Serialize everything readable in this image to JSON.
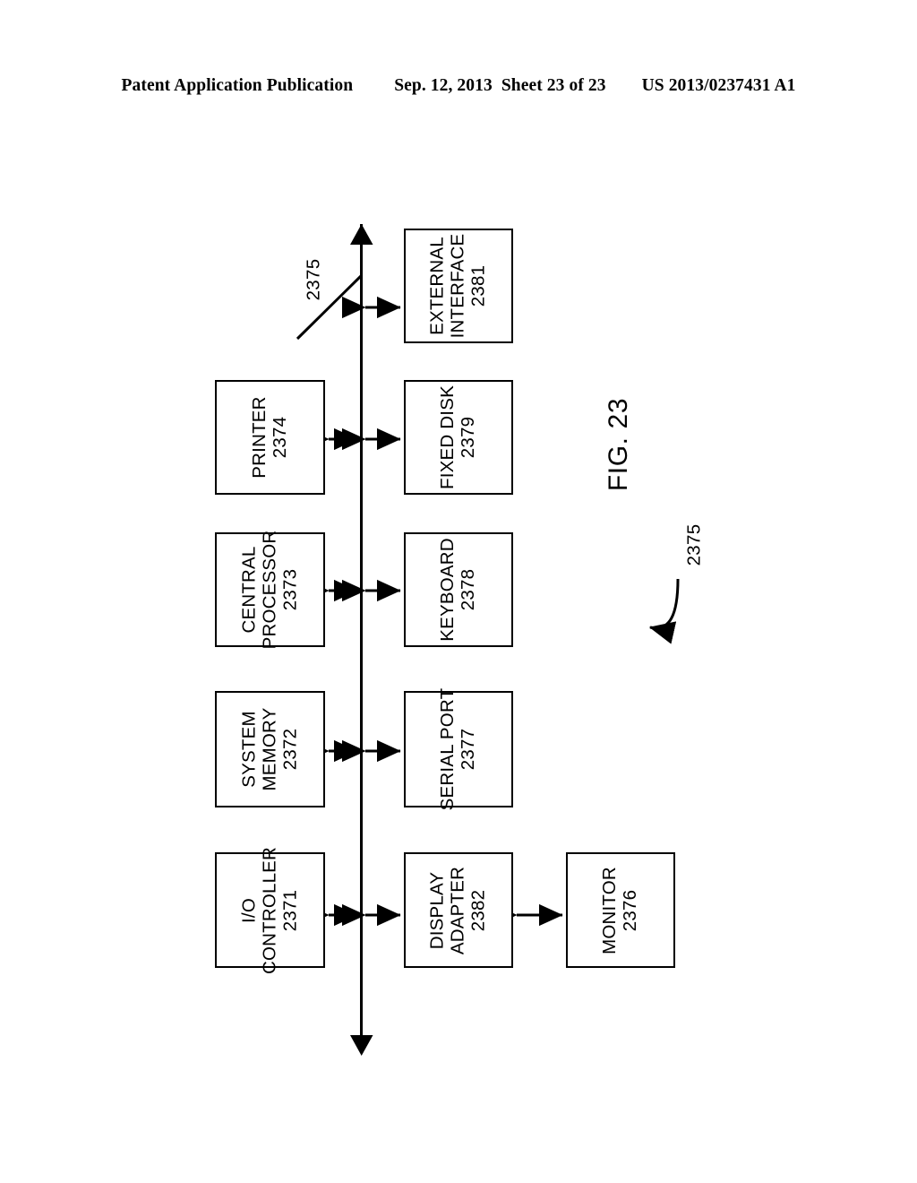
{
  "header": {
    "publication": "Patent Application Publication",
    "date": "Sep. 12, 2013",
    "sheet": "Sheet 23 of 23",
    "patent_number": "US 2013/0237431 A1"
  },
  "figure": {
    "label": "FIG. 23",
    "bus_reference": "2375",
    "bus_reference_secondary": "2375",
    "blocks": [
      {
        "id": "external-interface",
        "line1": "EXTERNAL",
        "line2": "INTERFACE",
        "ref": "2381"
      },
      {
        "id": "printer",
        "line1": "PRINTER",
        "line2": "",
        "ref": "2374"
      },
      {
        "id": "fixed-disk",
        "line1": "FIXED DISK",
        "line2": "",
        "ref": "2379"
      },
      {
        "id": "central-processor",
        "line1": "CENTRAL",
        "line2": "PROCESSOR",
        "ref": "2373"
      },
      {
        "id": "keyboard",
        "line1": "KEYBOARD",
        "line2": "",
        "ref": "2378"
      },
      {
        "id": "system-memory",
        "line1": "SYSTEM",
        "line2": "MEMORY",
        "ref": "2372"
      },
      {
        "id": "serial-port",
        "line1": "SERIAL PORT",
        "line2": "",
        "ref": "2377"
      },
      {
        "id": "io-controller",
        "line1": "I/O",
        "line2": "CONTROLLER",
        "ref": "2371"
      },
      {
        "id": "display-adapter",
        "line1": "DISPLAY",
        "line2": "ADAPTER",
        "ref": "2382"
      },
      {
        "id": "monitor",
        "line1": "MONITOR",
        "line2": "",
        "ref": "2376"
      }
    ],
    "colors": {
      "ink": "#000000",
      "paper": "#ffffff"
    }
  }
}
